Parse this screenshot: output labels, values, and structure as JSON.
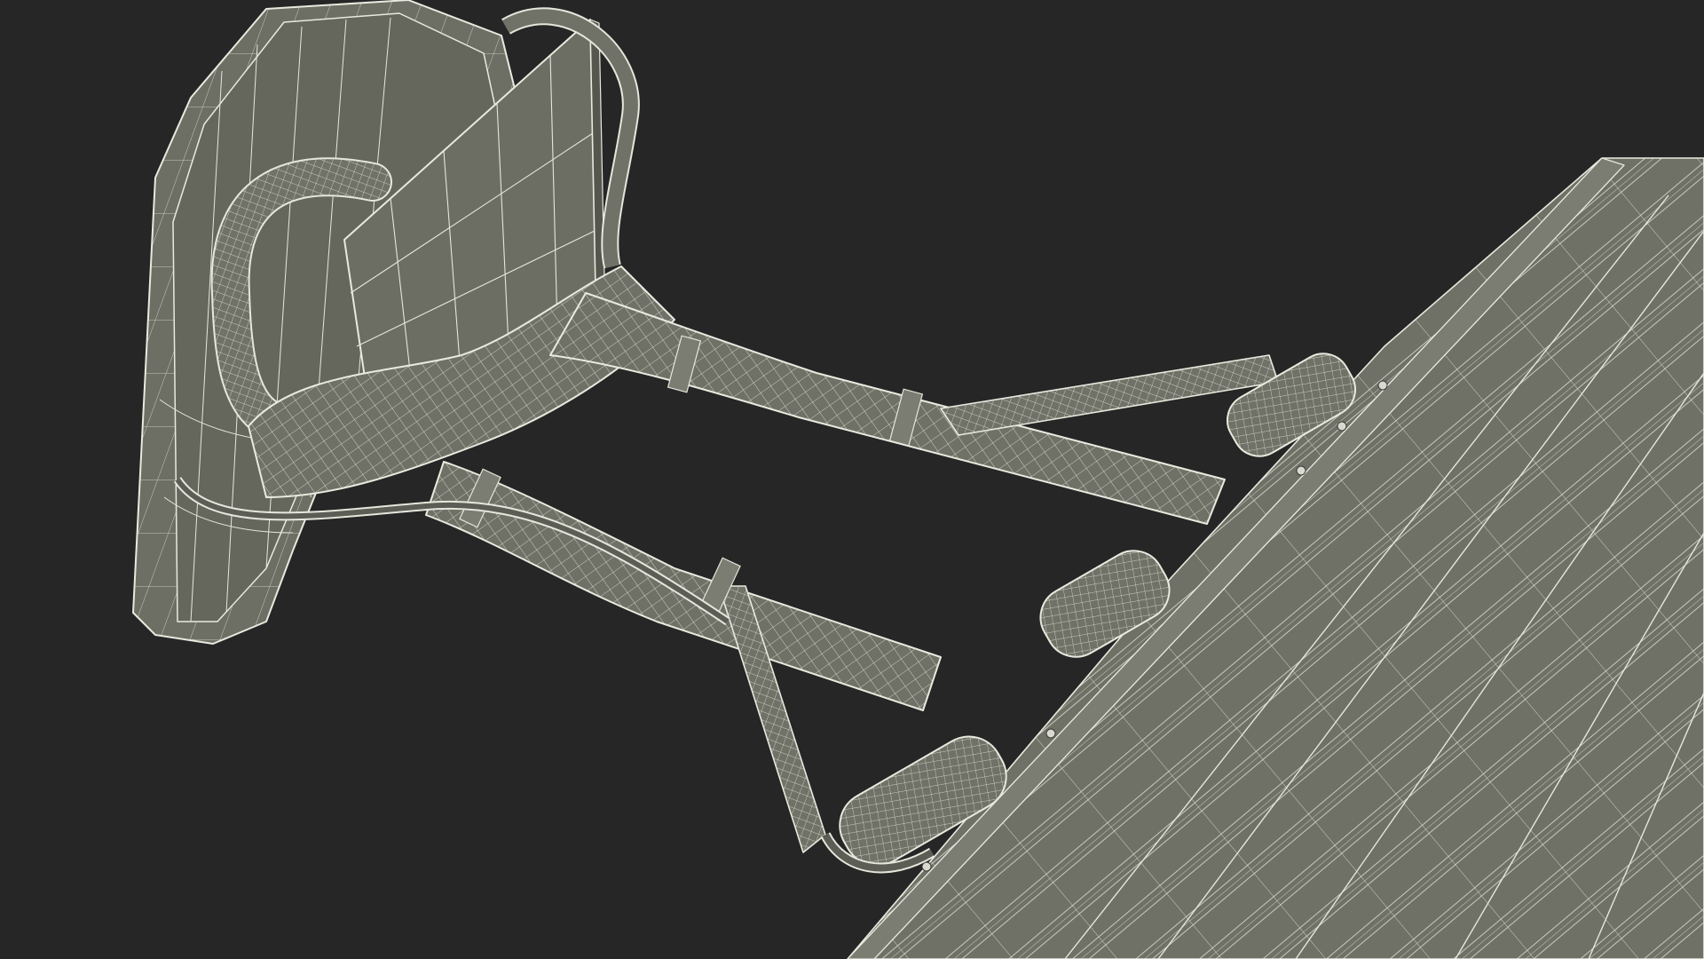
{
  "scene": {
    "subject": "wireframe-3d-model",
    "colors": {
      "background": "#262626",
      "surface": "#6f7166",
      "surface_dark": "#5c5e55",
      "surface_light": "#84867a",
      "wire": "#e6e6dc"
    }
  }
}
